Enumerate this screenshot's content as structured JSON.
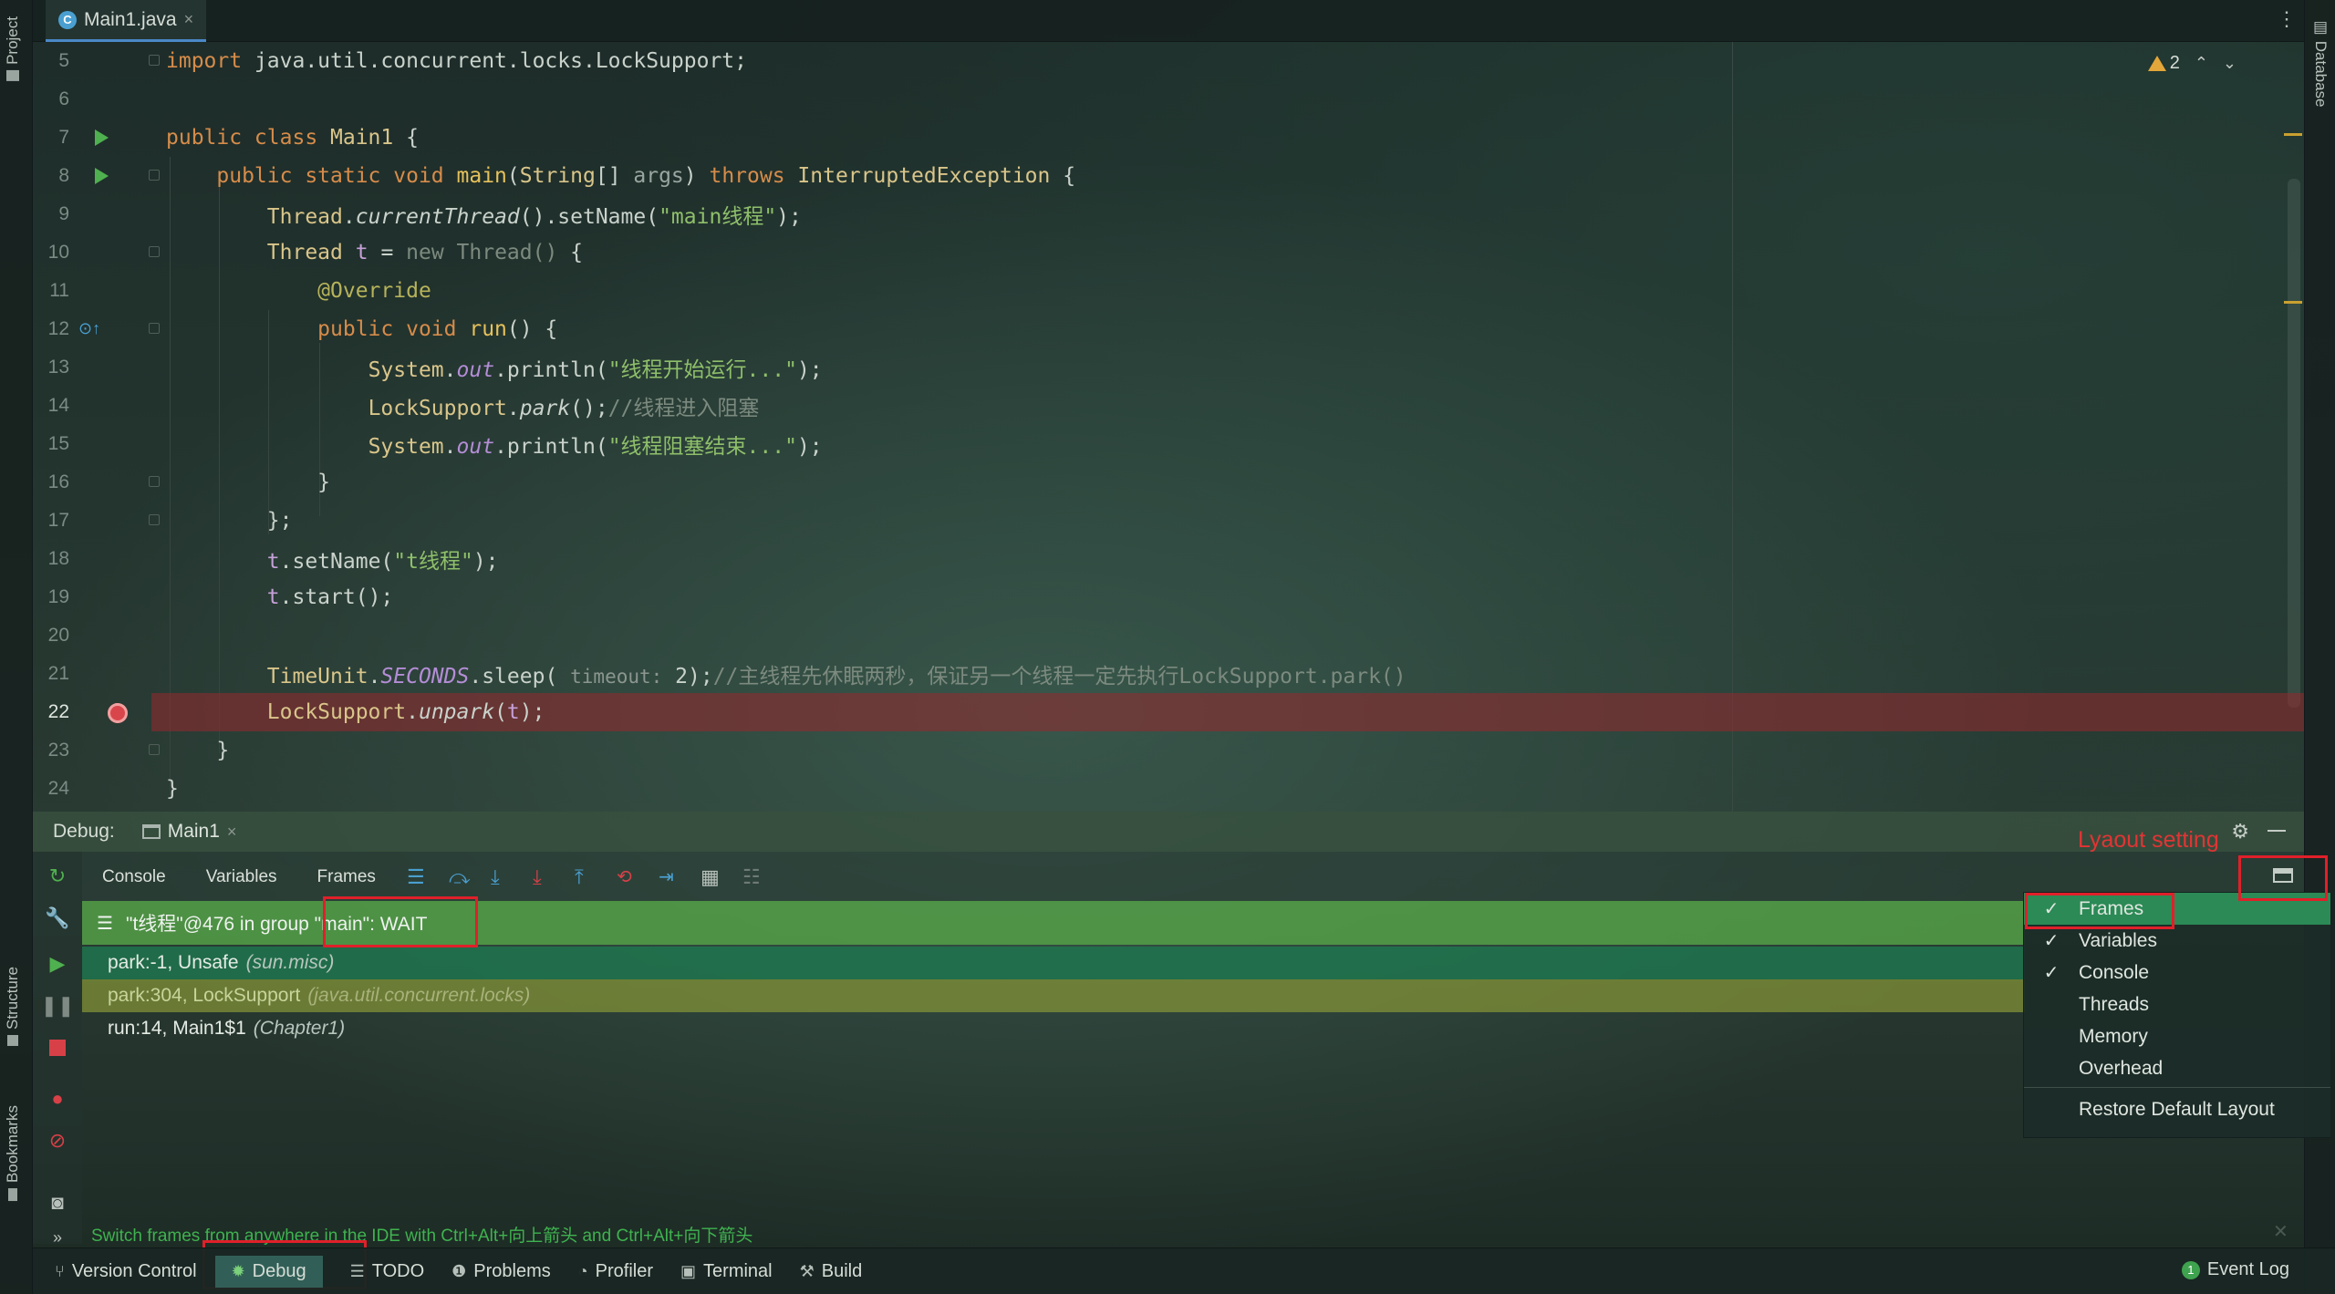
{
  "colors": {
    "breakpoint_line": "#96282d",
    "thread_row": "#54a048",
    "frame_selected": "#1e7850",
    "frame_lib": "#82913a",
    "menu_selected": "#2b8a55",
    "annotation_red": "#e0202a"
  },
  "left_stripe": {
    "project": "Project",
    "structure": "Structure",
    "bookmarks": "Bookmarks"
  },
  "right_stripe": {
    "database": "Database"
  },
  "editor_tab": {
    "filename": "Main1.java",
    "close": "×",
    "icon": "java-class-icon"
  },
  "warnings": {
    "count": "2"
  },
  "code_lines": [
    {
      "n": "5"
    },
    {
      "n": "6"
    },
    {
      "n": "7"
    },
    {
      "n": "8"
    },
    {
      "n": "9"
    },
    {
      "n": "10"
    },
    {
      "n": "11"
    },
    {
      "n": "12"
    },
    {
      "n": "13"
    },
    {
      "n": "14"
    },
    {
      "n": "15"
    },
    {
      "n": "16"
    },
    {
      "n": "17"
    },
    {
      "n": "18"
    },
    {
      "n": "19"
    },
    {
      "n": "20"
    },
    {
      "n": "21"
    },
    {
      "n": "22"
    },
    {
      "n": "23"
    },
    {
      "n": "24"
    }
  ],
  "code": {
    "l5": [
      "import",
      " java.util.concurrent.locks.LockSupport;"
    ],
    "l7": [
      "public class ",
      "Main1",
      " {"
    ],
    "l8": [
      "    public static void ",
      "main",
      "(",
      "String",
      "[] ",
      "args",
      ") ",
      "throws ",
      "InterruptedException",
      " {"
    ],
    "l9": [
      "        ",
      "Thread",
      ".",
      "currentThread",
      "().setName(",
      "\"main线程\"",
      ");"
    ],
    "l10": [
      "        ",
      "Thread",
      " ",
      "t",
      " = ",
      "new Thread()",
      " {"
    ],
    "l11": [
      "            ",
      "@Override"
    ],
    "l12": [
      "            ",
      "public void ",
      "run",
      "() {"
    ],
    "l13": [
      "                ",
      "System",
      ".",
      "out",
      ".println(",
      "\"线程开始运行...\"",
      ");"
    ],
    "l14": [
      "                ",
      "LockSupport",
      ".",
      "park",
      "();",
      "//线程进入阻塞"
    ],
    "l15": [
      "                ",
      "System",
      ".",
      "out",
      ".println(",
      "\"线程阻塞结束...\"",
      ");"
    ],
    "l16": "            }",
    "l17": "        };",
    "l18": [
      "        ",
      "t",
      ".setName(",
      "\"t线程\"",
      ");"
    ],
    "l19": [
      "        ",
      "t",
      ".start();"
    ],
    "l21": [
      "        ",
      "TimeUnit",
      ".",
      "SECONDS",
      ".sleep( ",
      "timeout:",
      " 2);",
      "//主线程先休眠两秒，保证另一个线程一定先执行LockSupport.park()"
    ],
    "l22": [
      "        ",
      "LockSupport",
      ".",
      "unpark",
      "(",
      "t",
      ");"
    ],
    "l23": "    }",
    "l24": "}"
  },
  "debug": {
    "title": "Debug:",
    "session": "Main1",
    "close": "×",
    "tabs": [
      "Console",
      "Variables",
      "Frames"
    ],
    "thread": "\"t线程\"@476 in group \"main\": WAIT",
    "frames": [
      {
        "name": "park:-1, Unsafe",
        "pkg": "(sun.misc)"
      },
      {
        "name": "park:304, LockSupport",
        "pkg": "(java.util.concurrent.locks)"
      },
      {
        "name": "run:14, Main1$1",
        "pkg": "(Chapter1)"
      }
    ],
    "hint": "Switch frames from anywhere in the IDE with Ctrl+Alt+向上箭头 and Ctrl+Alt+向下箭头",
    "annotation": "Lyaout setting"
  },
  "layout_menu": {
    "items": [
      {
        "label": "Frames",
        "checked": "✓"
      },
      {
        "label": "Variables",
        "checked": "✓"
      },
      {
        "label": "Console",
        "checked": "✓"
      },
      {
        "label": "Threads",
        "checked": ""
      },
      {
        "label": "Memory",
        "checked": ""
      },
      {
        "label": "Overhead",
        "checked": ""
      },
      {
        "label": "Restore Default Layout",
        "checked": ""
      }
    ]
  },
  "status_bar": {
    "version_control": "Version Control",
    "debug": "Debug",
    "todo": "TODO",
    "problems": "Problems",
    "profiler": "Profiler",
    "terminal": "Terminal",
    "build": "Build",
    "event_log": "Event Log",
    "event_count": "1"
  }
}
